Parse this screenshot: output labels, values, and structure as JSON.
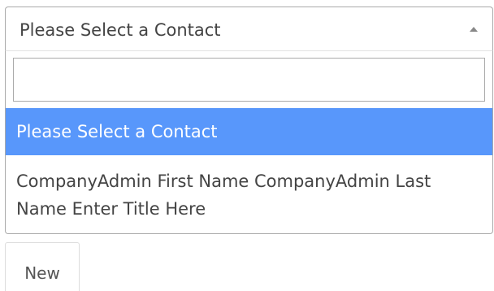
{
  "contact_select": {
    "selected_label": "Please Select a Contact",
    "arrow_icon": "triangle-up-icon",
    "search": {
      "value": "",
      "placeholder": ""
    },
    "options": [
      {
        "label": "Please Select a Contact",
        "highlighted": true
      },
      {
        "label": "CompanyAdmin First Name CompanyAdmin Last Name Enter Title Here",
        "highlighted": false
      }
    ]
  },
  "new_button": {
    "label": "New"
  },
  "colors": {
    "highlight": "#5897fb",
    "border": "#aaaaaa",
    "text": "#444444"
  }
}
